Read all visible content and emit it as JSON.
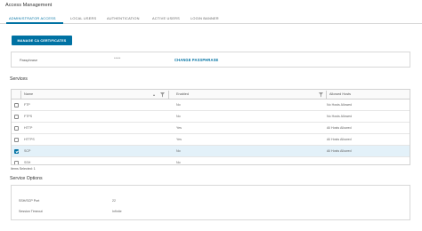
{
  "page": {
    "title": "Access Management"
  },
  "tabs": [
    {
      "label": "Administrator Access",
      "active": true
    },
    {
      "label": "Local Users",
      "active": false
    },
    {
      "label": "Authentication",
      "active": false
    },
    {
      "label": "Active Users",
      "active": false
    },
    {
      "label": "Login Banner",
      "active": false
    }
  ],
  "actions": {
    "manage_ca": "Manage CA Certificates"
  },
  "passphrase": {
    "label": "Passphrase",
    "value": "*****",
    "change_link": "Change Passphrase"
  },
  "services": {
    "title": "Services",
    "columns": {
      "name": "Name",
      "enabled": "Enabled",
      "allowed_hosts": "Allowed Hosts"
    },
    "rows": [
      {
        "name": "FTP",
        "enabled": "No",
        "allowed_hosts": "No Hosts Allowed",
        "checked": false
      },
      {
        "name": "FTPS",
        "enabled": "No",
        "allowed_hosts": "No Hosts Allowed",
        "checked": false
      },
      {
        "name": "HTTP",
        "enabled": "Yes",
        "allowed_hosts": "All Hosts Allowed",
        "checked": false
      },
      {
        "name": "HTTPS",
        "enabled": "Yes",
        "allowed_hosts": "All Hosts Allowed",
        "checked": false
      },
      {
        "name": "SCP",
        "enabled": "No",
        "allowed_hosts": "All Hosts Allowed",
        "checked": true
      },
      {
        "name": "SSH",
        "enabled": "No",
        "allowed_hosts": "",
        "checked": false
      }
    ],
    "footer": "Items Selected: 1"
  },
  "service_options": {
    "title": "Service Options",
    "items": [
      {
        "label": "SSH/SCP Port",
        "value": "22"
      },
      {
        "label": "Session Timeout",
        "value": "Infinite"
      }
    ]
  },
  "colors": {
    "accent": "#0072a3",
    "selected_row": "#e3f1f9",
    "border": "#d8d8d8"
  }
}
